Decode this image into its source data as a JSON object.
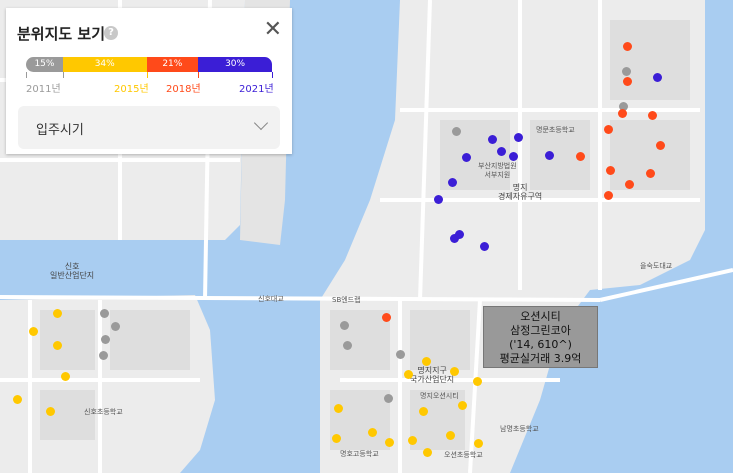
{
  "panel": {
    "title": "분위지도 보기",
    "help_icon": "question-circle-icon",
    "close_icon": "close-icon",
    "distribution": [
      {
        "percent": "15%",
        "color": "#9a9a9a"
      },
      {
        "percent": "34%",
        "color": "#ffc800"
      },
      {
        "percent": "21%",
        "color": "#ff4a1a"
      },
      {
        "percent": "30%",
        "color": "#3b1ed6"
      }
    ],
    "years": [
      {
        "label": "2011년",
        "color": "#9a9a9a"
      },
      {
        "label": "2015년",
        "color": "#ffc800"
      },
      {
        "label": "2018년",
        "color": "#ff4a1a"
      },
      {
        "label": "2021년",
        "color": "#3b1ed6"
      }
    ],
    "select": {
      "value": "입주시기"
    }
  },
  "tooltip": {
    "lines": [
      "오션시티",
      "삼정그린코아",
      "('14, 610^)",
      "평균실거래 3.9억"
    ]
  },
  "map": {
    "labels": [
      "신호\n일반산업단지",
      "신호대교",
      "SB엔드랩",
      "명지\n경제자유구역",
      "을숙도대교",
      "명지지구\n국가산업단지",
      "오션초등학교",
      "명호고등학교",
      "명문초등학교",
      "신호초등학교",
      "부산지방법원\n서부지원",
      "명지오션시티",
      "남명초등학교"
    ]
  }
}
